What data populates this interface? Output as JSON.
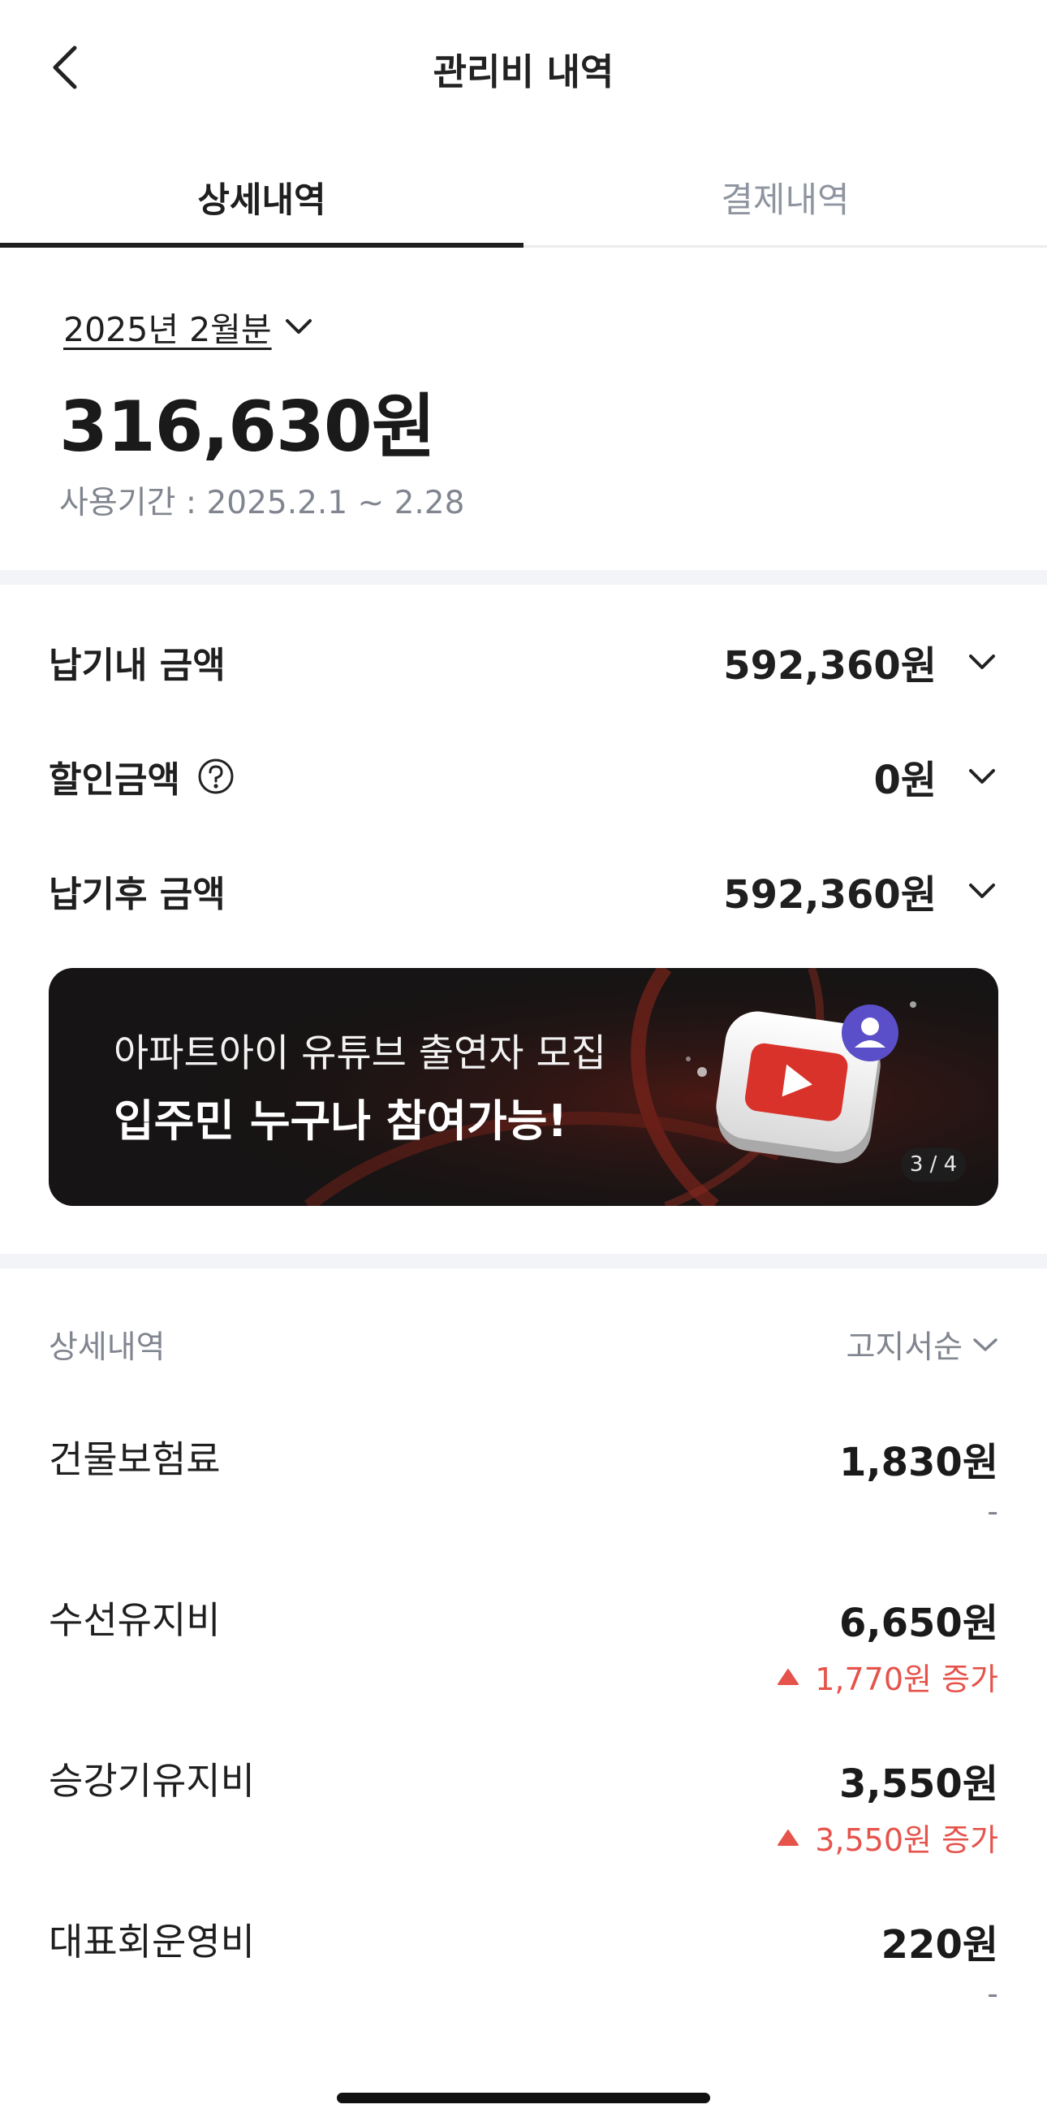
{
  "header": {
    "title": "관리비 내역",
    "back_icon": "chevron-left-icon"
  },
  "tabs": [
    {
      "label": "상세내역",
      "active": true
    },
    {
      "label": "결제내역",
      "active": false
    }
  ],
  "summary": {
    "month": "2025년 2월분",
    "total": "316,630원",
    "period": "사용기간 : 2025.2.1 ~ 2.28"
  },
  "amounts": [
    {
      "label": "납기내 금액",
      "value": "592,360원",
      "has_help": false
    },
    {
      "label": "할인금액",
      "value": "0원",
      "has_help": true
    },
    {
      "label": "납기후 금액",
      "value": "592,360원",
      "has_help": false
    }
  ],
  "banner": {
    "line1": "아파트아이 유튜브 출연자 모집",
    "line2": "입주민 누구나 참여가능!",
    "counter": "3 / 4"
  },
  "details": {
    "title": "상세내역",
    "sort": "고지서순",
    "items": [
      {
        "name": "건물보험료",
        "amount": "1,830원",
        "change": "-",
        "increase": false
      },
      {
        "name": "수선유지비",
        "amount": "6,650원",
        "change": "1,770원 증가",
        "increase": true
      },
      {
        "name": "승강기유지비",
        "amount": "3,550원",
        "change": "3,550원 증가",
        "increase": true
      },
      {
        "name": "대표회운영비",
        "amount": "220원",
        "change": "-",
        "increase": false
      }
    ]
  },
  "colors": {
    "accent_red": "#e5534b",
    "muted": "#80858f",
    "text": "#1f1f1f"
  }
}
